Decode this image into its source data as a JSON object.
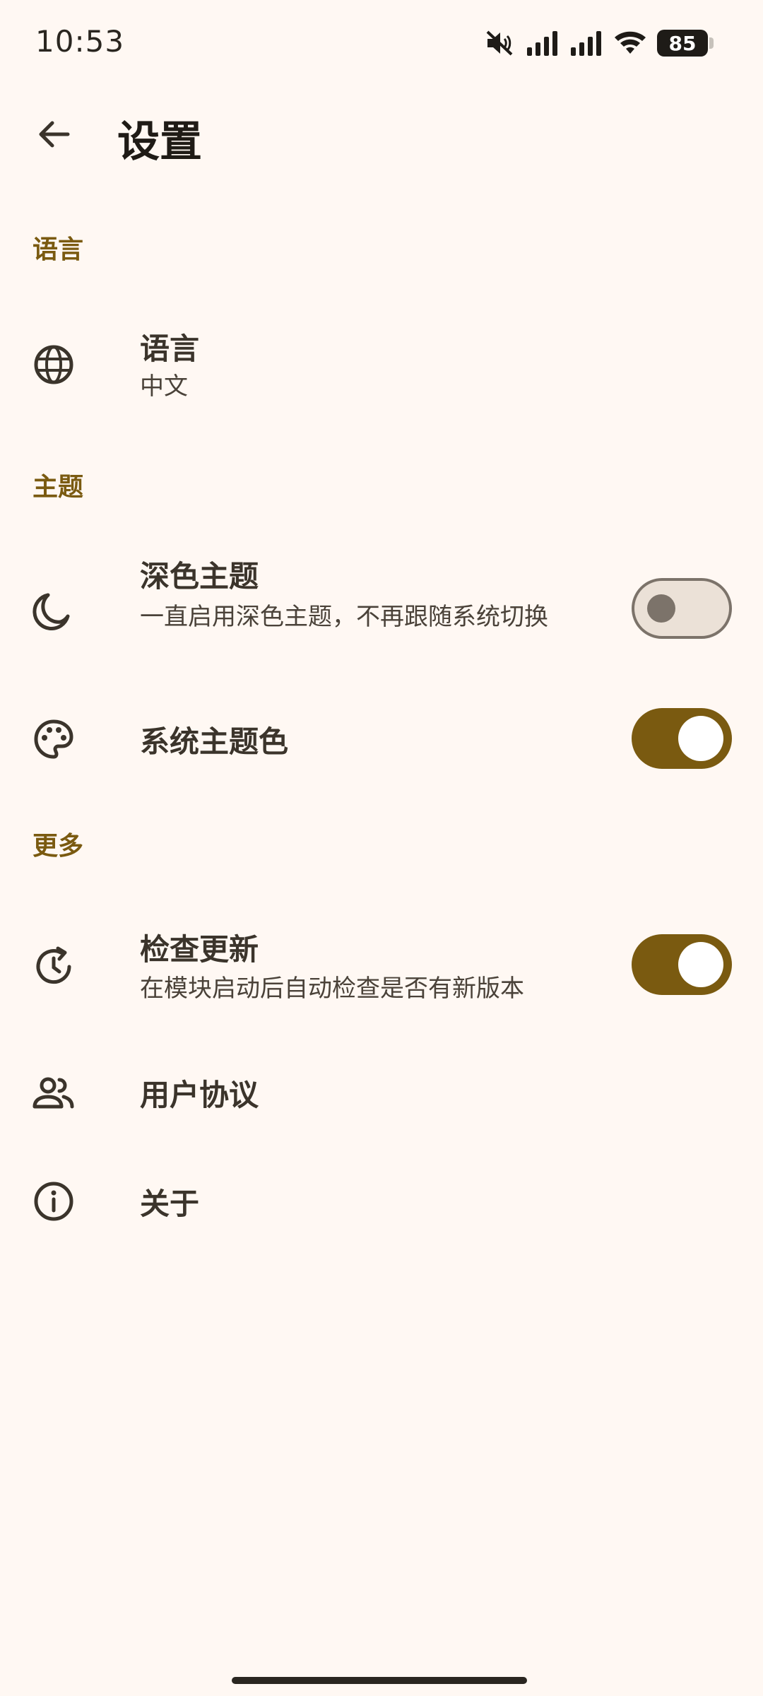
{
  "status_bar": {
    "time": "10:53",
    "battery": "85",
    "icons": [
      "mute-icon",
      "signal-icon",
      "signal-icon",
      "wifi-icon",
      "battery-icon"
    ]
  },
  "app_bar": {
    "title": "设置",
    "back_icon": "arrow-back-icon"
  },
  "sections": {
    "language": {
      "header": "语言",
      "items": [
        {
          "icon": "globe-icon",
          "title": "语言",
          "subtitle": "中文"
        }
      ]
    },
    "theme": {
      "header": "主题",
      "items": [
        {
          "icon": "moon-icon",
          "title": "深色主题",
          "subtitle": "一直启用深色主题，不再跟随系统切换",
          "switch": "off"
        },
        {
          "icon": "palette-icon",
          "title": "系统主题色",
          "switch": "on"
        }
      ]
    },
    "more": {
      "header": "更多",
      "items": [
        {
          "icon": "update-icon",
          "title": "检查更新",
          "subtitle": "在模块启动后自动检查是否有新版本",
          "switch": "on"
        },
        {
          "icon": "people-icon",
          "title": "用户协议"
        },
        {
          "icon": "info-icon",
          "title": "关于"
        }
      ]
    }
  },
  "colors": {
    "background": "#fff8f3",
    "accent": "#7a5a10",
    "text": "#3b342b",
    "switch_off_track": "#ebe1d7",
    "switch_off_outline": "#7c736a"
  }
}
